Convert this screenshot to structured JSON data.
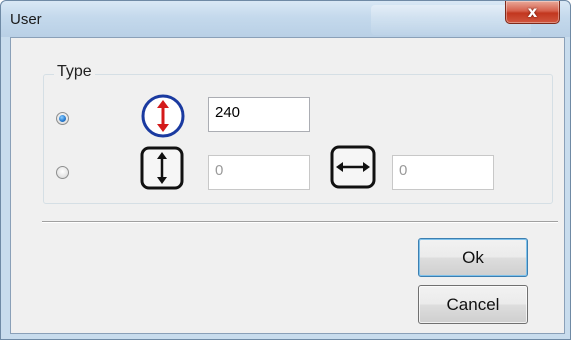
{
  "window": {
    "title": "User",
    "close_glyph": "x"
  },
  "group": {
    "legend": "Type",
    "options": [
      {
        "icon": "vertical-resize-circle-icon",
        "checked": true,
        "value": "240"
      },
      {
        "icon": "vertical-resize-square-icon",
        "checked": false,
        "value": "0",
        "secondary_icon": "horizontal-resize-square-icon",
        "secondary_value": "0"
      }
    ]
  },
  "buttons": {
    "ok_label": "Ok",
    "cancel_label": "Cancel"
  },
  "colors": {
    "circle_icon_ring": "#1a3aa0",
    "circle_icon_arrow": "#d41a1a",
    "radio_checked": "#2a7fd4",
    "close_button": "#c8432d"
  }
}
